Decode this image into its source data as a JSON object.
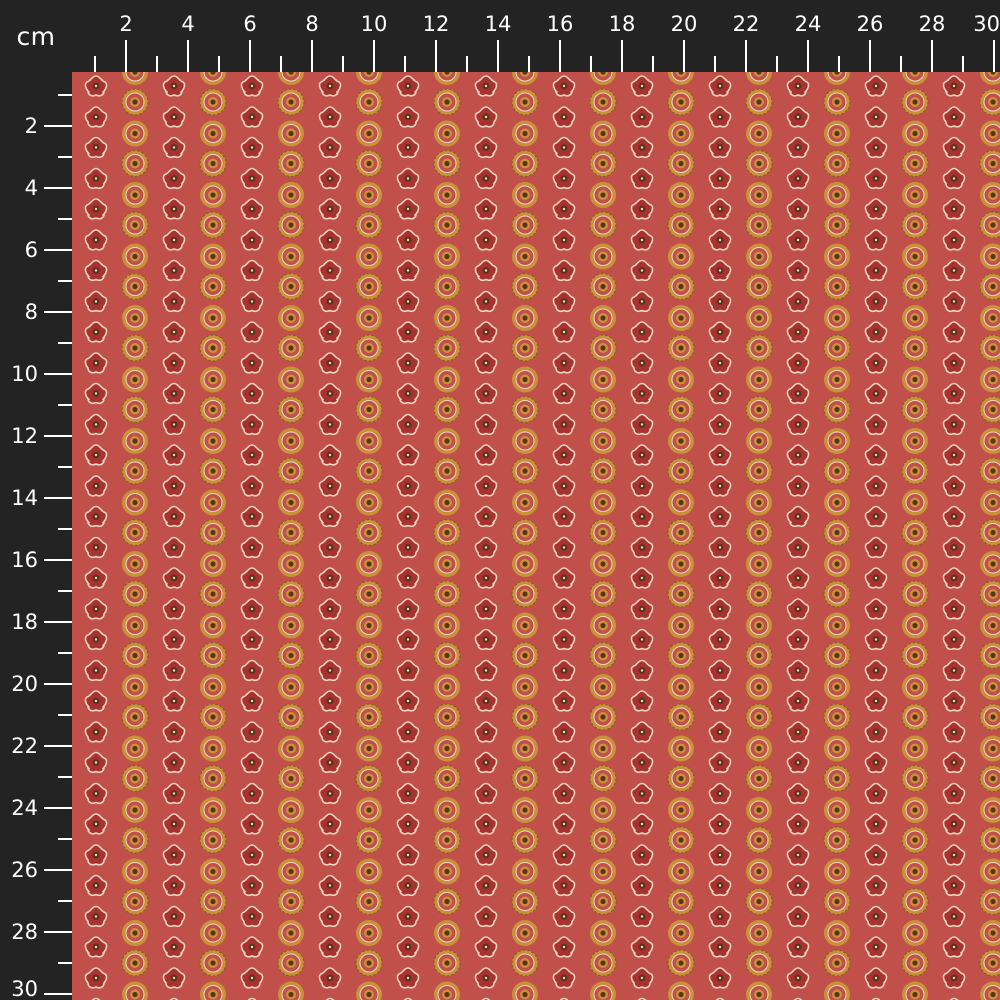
{
  "ruler": {
    "unit": "cm",
    "top_labels": [
      "2",
      "4",
      "6",
      "8",
      "10",
      "12",
      "14",
      "16",
      "18",
      "20",
      "22",
      "24",
      "26",
      "28",
      "30"
    ],
    "left_labels": [
      "2",
      "4",
      "6",
      "8",
      "10",
      "12",
      "14",
      "16",
      "18",
      "20",
      "22",
      "24",
      "26",
      "28",
      "30"
    ],
    "color": "#ffffff",
    "background": "#232323"
  },
  "fabric": {
    "pattern": "vertical stripes of alternating small flower and ornate medallion motifs",
    "background_color": "#c2504a",
    "accent_colors": {
      "gold": "#c9923a",
      "dark_brown": "#5a3418",
      "cream": "#f2d6c2",
      "deep_red": "#a8322f"
    }
  }
}
